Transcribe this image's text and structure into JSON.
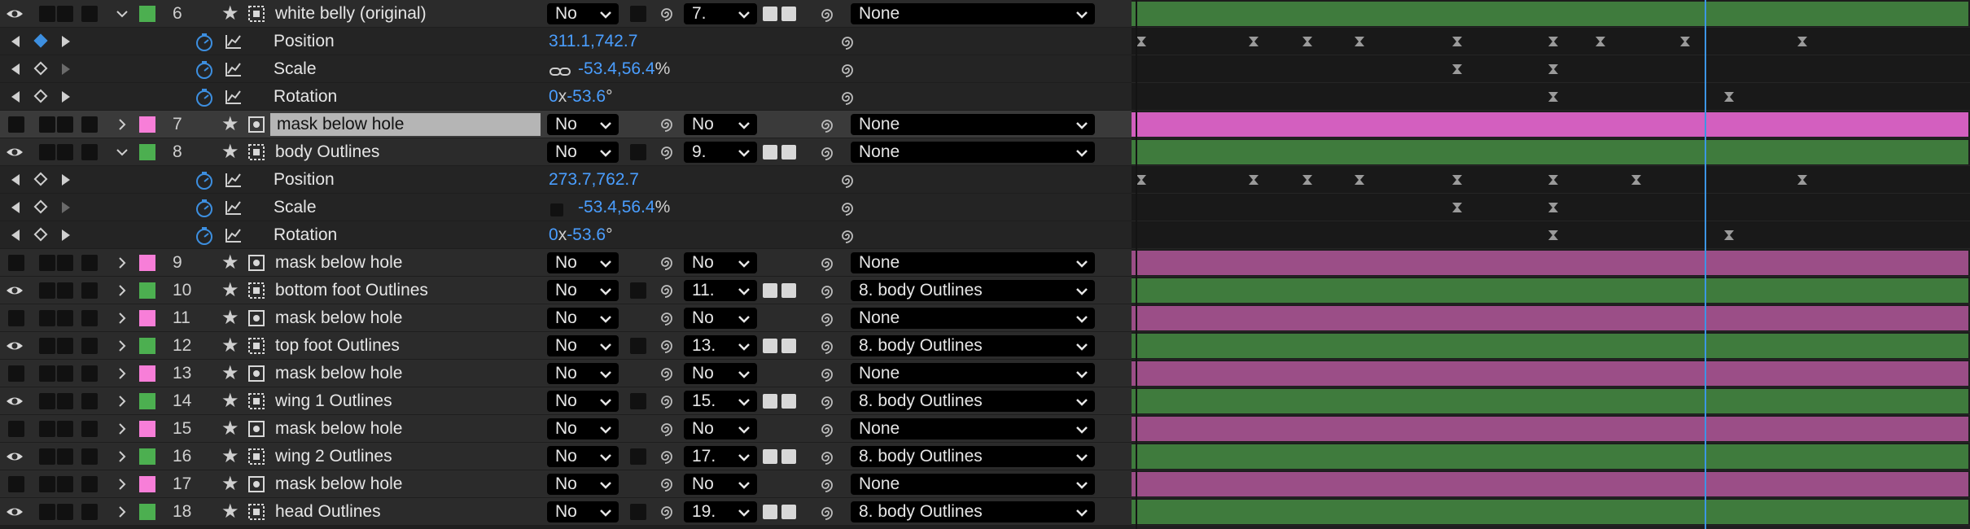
{
  "colors": {
    "label_green": "#4caf50",
    "label_pink": "#f77ed8",
    "bar_green": "#3f7b3d",
    "bar_pink": "#9b4e87",
    "bar_hot_pink": "#d35fbf",
    "value_blue": "#4a9eff",
    "cti_blue": "#3c95e4"
  },
  "layers": [
    {
      "index": "6",
      "name": "white belly (original)",
      "label": "green",
      "visible": true,
      "expanded": true,
      "mode": "No",
      "trkmat": "",
      "parent_field": "7.",
      "parent": "None",
      "bar": "green",
      "selected": false,
      "props": [
        {
          "name": "Position",
          "value": "311.1,742.7",
          "navL": true,
          "kfActive": true
        },
        {
          "name": "Scale",
          "value_prefix": "",
          "value_a": "-53.4,56.4",
          "value_suffix": "%",
          "link": true
        },
        {
          "name": "Rotation",
          "value_a": "0",
          "value_mid": "x",
          "value_b": "-53.6",
          "value_suffix": "°"
        }
      ]
    },
    {
      "index": "7",
      "name": "mask below hole",
      "label": "pink",
      "visible": false,
      "expanded": false,
      "mode": "No",
      "trkmat": "No",
      "parent": "None",
      "bar": "hot",
      "selected": true
    },
    {
      "index": "8",
      "name": "body Outlines",
      "label": "green",
      "visible": true,
      "expanded": true,
      "mode": "No",
      "trkmat": "",
      "parent_field": "9.",
      "parent": "None",
      "bar": "green",
      "props": [
        {
          "name": "Position",
          "value": "273.7,762.7"
        },
        {
          "name": "Scale",
          "value_a": "-53.4,56.4",
          "value_suffix": "%"
        },
        {
          "name": "Rotation",
          "value_a": "0",
          "value_mid": "x",
          "value_b": "-53.6",
          "value_suffix": "°"
        }
      ]
    },
    {
      "index": "9",
      "name": "mask below hole",
      "label": "pink",
      "visible": false,
      "mode": "No",
      "trkmat": "No",
      "parent": "None",
      "bar": "pink"
    },
    {
      "index": "10",
      "name": "bottom foot Outlines",
      "label": "green",
      "visible": true,
      "mode": "No",
      "parent_field": "11.",
      "parent": "8. body Outlines",
      "bar": "green"
    },
    {
      "index": "11",
      "name": "mask below hole",
      "label": "pink",
      "visible": false,
      "mode": "No",
      "trkmat": "No",
      "parent": "None",
      "bar": "pink"
    },
    {
      "index": "12",
      "name": "top foot Outlines",
      "label": "green",
      "visible": true,
      "mode": "No",
      "parent_field": "13.",
      "parent": "8. body Outlines",
      "bar": "green"
    },
    {
      "index": "13",
      "name": "mask below hole",
      "label": "pink",
      "visible": false,
      "mode": "No",
      "trkmat": "No",
      "parent": "None",
      "bar": "pink"
    },
    {
      "index": "14",
      "name": "wing 1 Outlines",
      "label": "green",
      "visible": true,
      "mode": "No",
      "parent_field": "15.",
      "parent": "8. body Outlines",
      "bar": "green"
    },
    {
      "index": "15",
      "name": "mask below hole",
      "label": "pink",
      "visible": false,
      "mode": "No",
      "trkmat": "No",
      "parent": "None",
      "bar": "pink"
    },
    {
      "index": "16",
      "name": "wing 2 Outlines",
      "label": "green",
      "visible": true,
      "mode": "No",
      "parent_field": "17.",
      "parent": "8. body Outlines",
      "bar": "green"
    },
    {
      "index": "17",
      "name": "mask below hole",
      "label": "pink",
      "visible": false,
      "mode": "No",
      "trkmat": "No",
      "parent": "None",
      "bar": "pink"
    },
    {
      "index": "18",
      "name": "head Outlines",
      "label": "green",
      "visible": true,
      "mode": "No",
      "parent_field": "19.",
      "parent": "8. body Outlines",
      "bar": "green"
    }
  ]
}
